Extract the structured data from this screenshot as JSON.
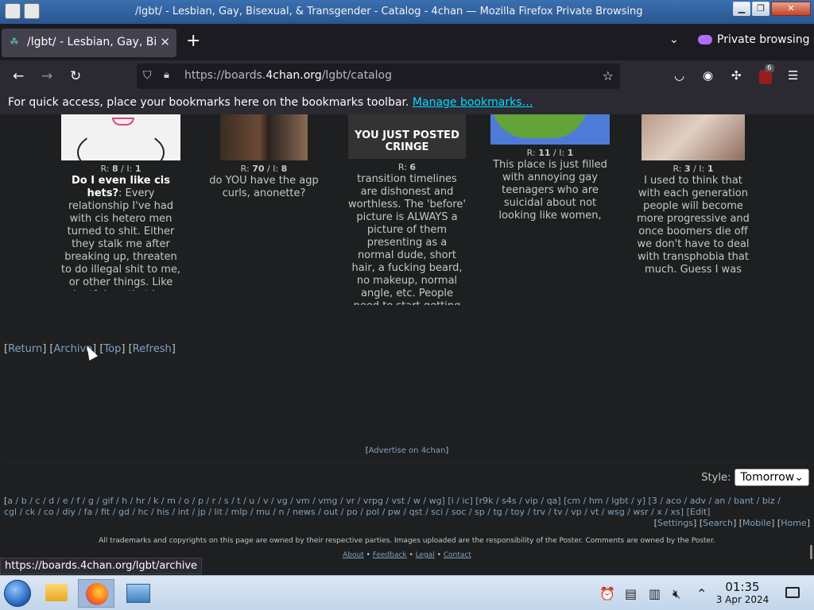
{
  "window": {
    "title": "/lgbt/ - Lesbian, Gay, Bisexual, & Transgender - Catalog - 4chan — Mozilla Firefox Private Browsing"
  },
  "tab": {
    "title": "/lgbt/ - Lesbian, Gay, Bisexual"
  },
  "browser": {
    "private_label": "Private browsing",
    "url_prefix": "https://boards.",
    "url_host": "4chan.org",
    "url_path": "/lgbt/catalog",
    "ublock_count": "6",
    "bookmarks_prompt": "For quick access, place your bookmarks here on the bookmarks toolbar.",
    "manage_bookmarks": "Manage bookmarks…"
  },
  "catalog": {
    "threads": [
      {
        "replies": "8",
        "images": "1",
        "subject": "Do I even like cis hets?",
        "body": ": Every relationship I've had with cis hetero men turned to shit. Either they stalk me after breaking up, threaten to do illegal shit to me, or other things. Like why tf does that keep happening? My only nice"
      },
      {
        "replies": "70",
        "images": "8",
        "subject": "",
        "body": "do YOU have the agp curls, anonette?"
      },
      {
        "replies": "6",
        "images": "",
        "subject": "",
        "thumb_text": "YOU JUST POSTED CRINGE",
        "body": "transition timelines are dishonest and worthless. The 'before' picture is ALWAYS a picture of them presenting as a normal dude, short hair, a fucking beard, no makeup, normal angle, etc. People need to start getting more shit for not"
      },
      {
        "replies": "11",
        "images": "1",
        "subject": "",
        "body": "This place is just filled with annoying gay teenagers who are suicidal about not looking like women, right?"
      },
      {
        "replies": "3",
        "images": "1",
        "subject": "",
        "body": "I used to think that with each generation people will become more progressive and once boomers die off we don't have to deal with transphobia that much. Guess I was wrong."
      }
    ]
  },
  "bottom_nav": {
    "return": "Return",
    "archive": "Archive",
    "top": "Top",
    "refresh": "Refresh"
  },
  "advertise": "Advertise on 4chan",
  "style": {
    "label": "Style:",
    "selected": "Tomorrow"
  },
  "boardlist": {
    "line1": "a / b / c / d / e / f / g / gif / h / hr / k / m / o / p / r / s / t / u / v / vg / vm / vmg / vr / vrpg / vst / w / wg] [i / ic] [r9k / s4s / vip / qa] [cm / hm / lgbt / y] [3 / aco / adv / an / bant / biz /",
    "line2": "cgl / ck / co / diy / fa / fit / gd / hc / his / int / jp / lit / mlp / mu / n / news / out / po / pol / pw / qst / sci / soc / sp / tg / toy / trv / tv / vp / vt / wsg / wsr / x / xs] [Edit]",
    "settings": "Settings",
    "search": "Search",
    "mobile": "Mobile",
    "home": "Home"
  },
  "disclaimer": "All trademarks and copyrights on this page are owned by their respective parties. Images uploaded are the responsibility of the Poster. Comments are owned by the Poster.",
  "footer": {
    "about": "About",
    "feedback": "Feedback",
    "legal": "Legal",
    "contact": "Contact"
  },
  "status_url": "https://boards.4chan.org/lgbt/archive",
  "taskbar": {
    "time": "01:35",
    "date": "3 Apr 2024"
  }
}
